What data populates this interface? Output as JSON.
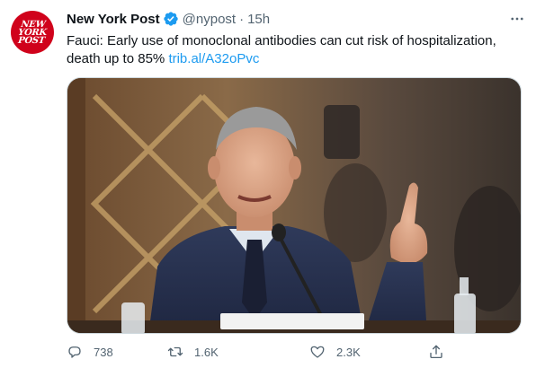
{
  "avatar": {
    "lines": [
      "NEW",
      "YORK",
      "POST"
    ],
    "color": "#d0021b"
  },
  "tweet": {
    "display_name": "New York Post",
    "handle": "@nypost",
    "separator": "·",
    "time": "15h",
    "text": "Fauci: Early use of monoclonal antibodies can cut risk of hospitalization, death up to 85% ",
    "link": "trib.al/A32oPvc"
  },
  "media": {
    "kind": "photo",
    "subject": "Man in suit speaking at microphone, pointing upward"
  },
  "actions": {
    "reply": {
      "icon": "reply-icon",
      "count": "738"
    },
    "retweet": {
      "icon": "retweet-icon",
      "count": "1.6K"
    },
    "like": {
      "icon": "heart-icon",
      "count": "2.3K"
    },
    "share": {
      "icon": "share-icon",
      "count": ""
    }
  },
  "colors": {
    "verified": "#1d9bf0",
    "link": "#1d9bf0",
    "muted": "#536471"
  }
}
